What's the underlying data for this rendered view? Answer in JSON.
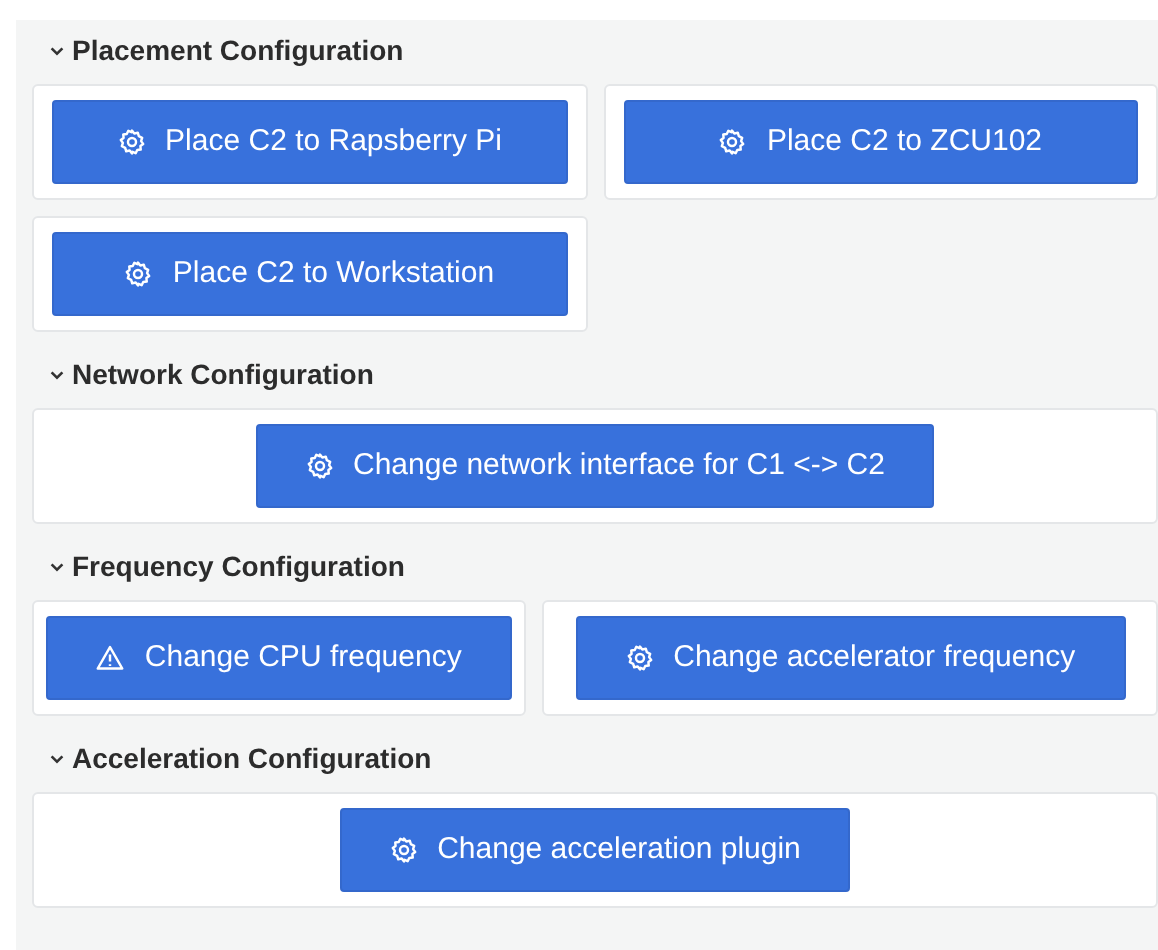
{
  "sections": [
    {
      "title": "Placement Configuration",
      "expanded": true,
      "actions": [
        {
          "label": "Place C2 to Rapsberry Pi",
          "kind": "setting"
        },
        {
          "label": "Place C2 to ZCU102",
          "kind": "setting"
        },
        {
          "label": "Place C2 to Workstation",
          "kind": "setting"
        }
      ]
    },
    {
      "title": "Network Configuration",
      "expanded": true,
      "actions": [
        {
          "label": "Change network interface for C1 <-> C2",
          "kind": "setting"
        }
      ]
    },
    {
      "title": "Frequency Configuration",
      "expanded": true,
      "actions": [
        {
          "label": "Change CPU frequency",
          "kind": "warning"
        },
        {
          "label": "Change accelerator frequency",
          "kind": "setting"
        }
      ]
    },
    {
      "title": "Acceleration Configuration",
      "expanded": true,
      "actions": [
        {
          "label": "Change acceleration plugin",
          "kind": "setting"
        }
      ]
    }
  ]
}
